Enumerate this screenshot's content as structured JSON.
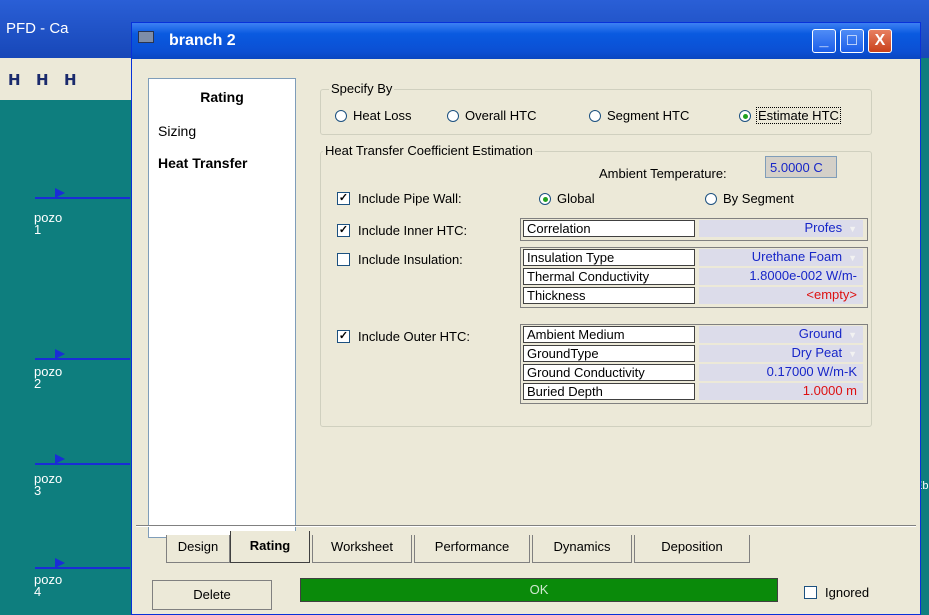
{
  "background_app": {
    "title": "PFD - Ca",
    "streams": [
      "pozo\n1",
      "pozo\n2",
      "pozo\n3",
      "pozo\n4"
    ],
    "right_label": "Eb"
  },
  "dialog": {
    "title": "branch 2",
    "window_buttons": {
      "minimize": "_",
      "maximize": "□",
      "close": "X"
    },
    "nav": {
      "header": "Rating",
      "items": [
        "Sizing",
        "Heat Transfer"
      ],
      "active": "Heat Transfer"
    },
    "specify_by": {
      "label": "Specify By",
      "options": [
        "Heat Loss",
        "Overall HTC",
        "Segment HTC",
        "Estimate HTC"
      ],
      "selected": "Estimate HTC"
    },
    "htc_estimation": {
      "label": "Heat Transfer Coefficient Estimation",
      "ambient_temperature_label": "Ambient Temperature:",
      "ambient_temperature_value": "5.0000 C",
      "pipe_wall": {
        "label": "Include Pipe Wall:",
        "checked": true,
        "options": [
          "Global",
          "By Segment"
        ],
        "selected": "Global"
      },
      "inner_htc": {
        "label": "Include Inner HTC:",
        "checked": true,
        "rows": [
          {
            "name": "Correlation",
            "value": "Profes"
          }
        ]
      },
      "insulation": {
        "label": "Include Insulation:",
        "checked": false,
        "rows": [
          {
            "name": "Insulation Type",
            "value": "Urethane Foam"
          },
          {
            "name": "Thermal Conductivity",
            "value": "1.8000e-002 W/m-"
          },
          {
            "name": "Thickness",
            "value": "<empty>"
          }
        ]
      },
      "outer_htc": {
        "label": "Include Outer HTC:",
        "checked": true,
        "rows": [
          {
            "name": "Ambient Medium",
            "value": "Ground"
          },
          {
            "name": "GroundType",
            "value": "Dry Peat"
          },
          {
            "name": "Ground Conductivity",
            "value": "0.17000 W/m-K"
          },
          {
            "name": "Buried Depth",
            "value": "1.0000 m"
          }
        ]
      }
    },
    "tabs": [
      "Design",
      "Rating",
      "Worksheet",
      "Performance",
      "Dynamics",
      "Deposition"
    ],
    "active_tab": "Rating",
    "delete_label": "Delete",
    "status": "OK",
    "status_color": "#0a8a0a",
    "ignored_label": "Ignored",
    "ignored_checked": false
  }
}
